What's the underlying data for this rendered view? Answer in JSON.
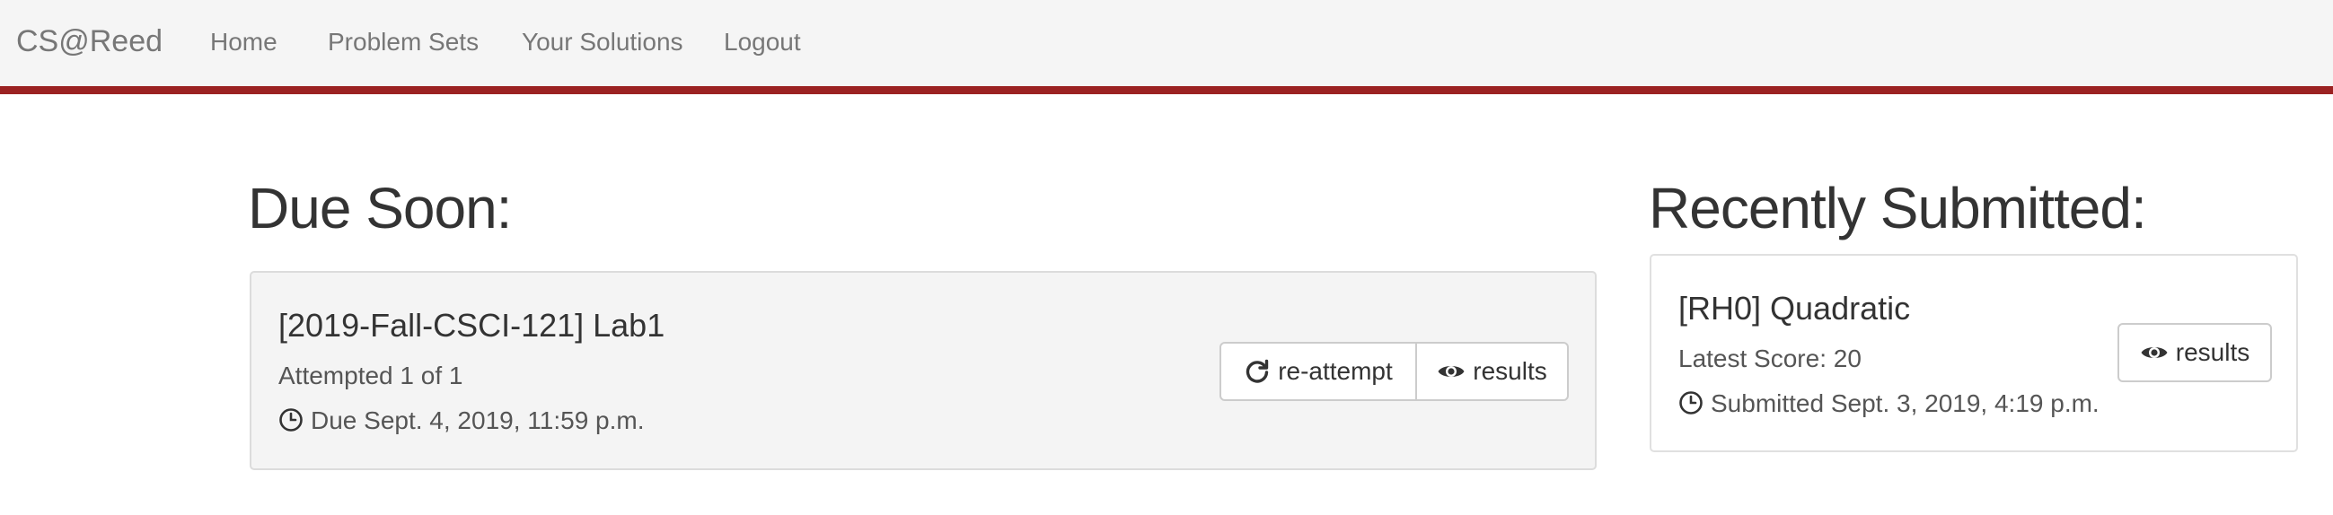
{
  "navbar": {
    "brand": "CS@Reed",
    "links": [
      "Home",
      "Problem Sets",
      "Your Solutions",
      "Logout"
    ]
  },
  "due_soon": {
    "heading": "Due Soon:",
    "items": [
      {
        "title": "[2019-Fall-CSCI-121] Lab1",
        "attempted": "Attempted 1 of 1",
        "due": "Due Sept. 4, 2019, 11:59 p.m.",
        "reattempt_label": "re-attempt",
        "results_label": "results"
      }
    ]
  },
  "recently_submitted": {
    "heading": "Recently Submitted:",
    "items": [
      {
        "title": "[RH0] Quadratic",
        "score": "Latest Score: 20",
        "submitted": "Submitted Sept. 3, 2019, 4:19 p.m.",
        "results_label": "results"
      }
    ]
  },
  "colors": {
    "navbar_bg": "#f5f5f5",
    "accent_bar": "#9b2222",
    "due_card_bg": "#f4f4f4"
  },
  "icons": {
    "clock": "clock-icon",
    "refresh": "refresh-icon",
    "eye": "eye-icon"
  }
}
